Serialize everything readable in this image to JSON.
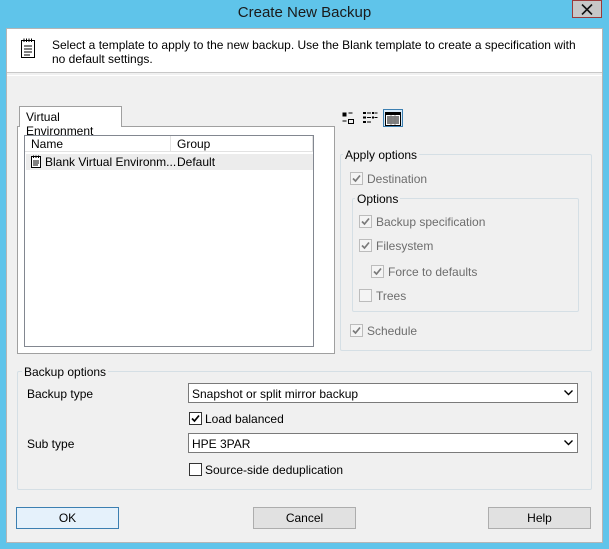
{
  "window": {
    "title": "Create New Backup"
  },
  "header": {
    "message": "Select a template to apply to the new backup. Use the Blank template to create a specification with no default settings."
  },
  "tabs": [
    {
      "label": "Virtual Environment",
      "selected": true
    }
  ],
  "template_list": {
    "columns": [
      "Name",
      "Group"
    ],
    "rows": [
      {
        "name": "Blank Virtual Environm...",
        "group": "Default",
        "icon": "document-icon"
      }
    ]
  },
  "view_buttons": [
    {
      "icon": "small-icons-view-icon",
      "active": false
    },
    {
      "icon": "list-view-icon",
      "active": false
    },
    {
      "icon": "details-view-icon",
      "active": true
    }
  ],
  "apply_options": {
    "legend": "Apply options",
    "destination": {
      "label": "Destination",
      "checked": true,
      "enabled": false
    },
    "options_legend": "Options",
    "backup_specification": {
      "label": "Backup specification",
      "checked": true,
      "enabled": false
    },
    "filesystem": {
      "label": "Filesystem",
      "checked": true,
      "enabled": false
    },
    "force_to_defaults": {
      "label": "Force to defaults",
      "checked": true,
      "enabled": false
    },
    "trees": {
      "label": "Trees",
      "checked": false,
      "enabled": false
    },
    "schedule": {
      "label": "Schedule",
      "checked": true,
      "enabled": false
    }
  },
  "backup_options": {
    "legend": "Backup options",
    "backup_type_label": "Backup type",
    "backup_type_value": "Snapshot or split mirror backup",
    "load_balanced": {
      "label": "Load balanced",
      "checked": true
    },
    "sub_type_label": "Sub type",
    "sub_type_value": "HPE 3PAR",
    "source_side_dedup": {
      "label": "Source-side deduplication",
      "checked": false
    }
  },
  "buttons": {
    "ok": "OK",
    "cancel": "Cancel",
    "help": "Help"
  },
  "colors": {
    "title_bar": "#5fc4ea",
    "dialog_bg": "#f0f0f0",
    "selection_accent": "#3c7fb1"
  }
}
